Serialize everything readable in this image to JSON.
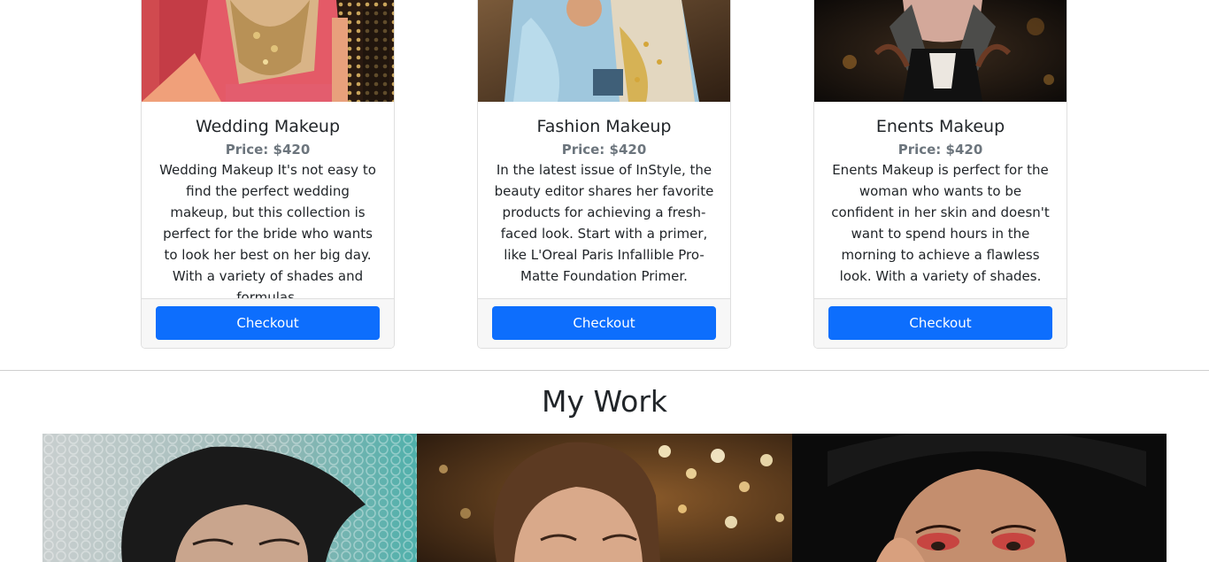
{
  "services": [
    {
      "title": "Wedding Makeup",
      "price": "Price: $420",
      "description": "Wedding Makeup It's not easy to find the perfect wedding makeup, but this collection is perfect for the bride who wants to look her best on her big day. With a variety of shades and formulas.",
      "button": "Checkout",
      "image": "bride-photo"
    },
    {
      "title": "Fashion Makeup",
      "price": "Price: $420",
      "description": "In the latest issue of InStyle, the beauty editor shares her favorite products for achieving a fresh-faced look. Start with a primer, like L'Oreal Paris Infallible Pro-Matte Foundation Primer.",
      "button": "Checkout",
      "image": "fashion-model-photo"
    },
    {
      "title": "Enents Makeup",
      "price": "Price: $420",
      "description": "Enents Makeup is perfect for the woman who wants to be confident in her skin and doesn't want to spend hours in the morning to achieve a flawless look. With a variety of shades.",
      "button": "Checkout",
      "image": "event-makeup-photo"
    }
  ],
  "my_work": {
    "title": "My Work",
    "images": [
      "hooded-woman-photo",
      "glitter-bokeh-portrait-photo",
      "red-eyeshadow-portrait-photo"
    ]
  },
  "colors": {
    "primary_button": "#0d6efd",
    "price_text": "#6c757d",
    "card_footer": "#f7f7f7"
  }
}
